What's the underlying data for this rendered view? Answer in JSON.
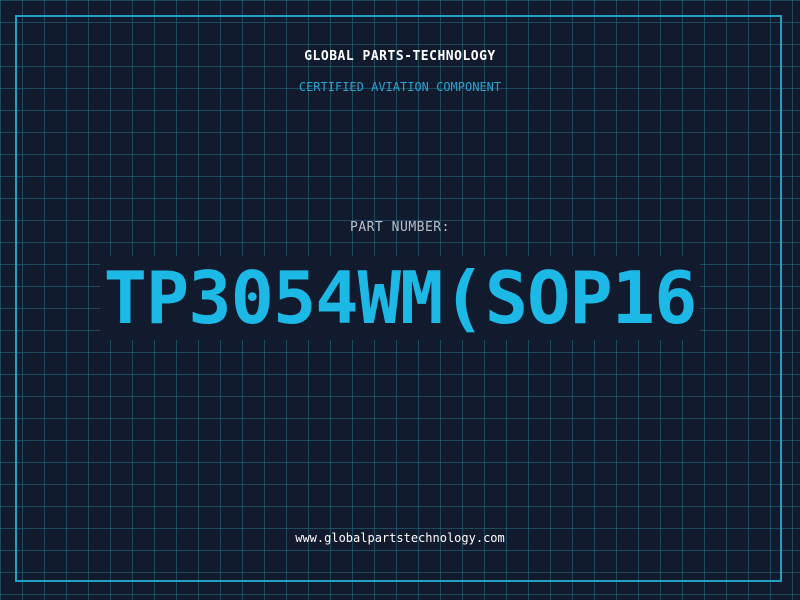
{
  "header": {
    "company": "GLOBAL PARTS-TECHNOLOGY",
    "subtitle": "CERTIFIED AVIATION COMPONENT"
  },
  "main": {
    "label": "PART NUMBER:",
    "part_number": "TP3054WM(SOP16"
  },
  "footer": {
    "url": "www.globalpartstechnology.com"
  },
  "colors": {
    "background": "#121a2e",
    "grid": "#286e82",
    "frame": "#21a0c4",
    "accent": "#1cb8e6",
    "subtitle": "#2aa3d2"
  }
}
